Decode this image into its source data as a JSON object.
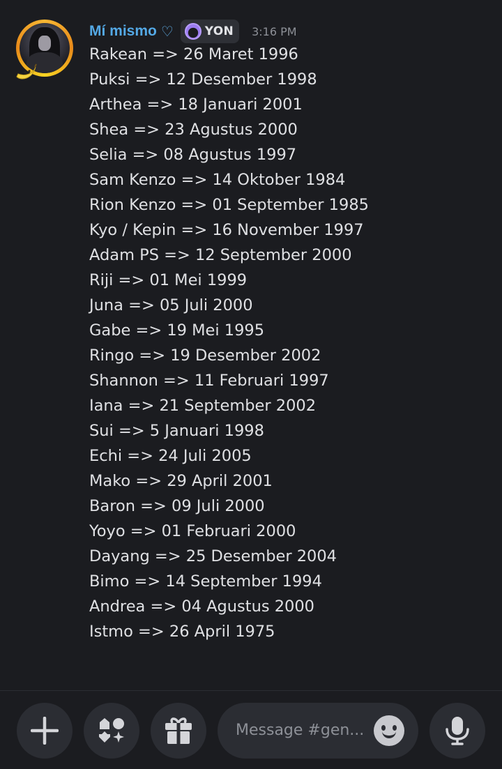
{
  "message": {
    "username": "Mí mismo",
    "heart_glyph": "♡",
    "tag": "YON",
    "timestamp": "3:16 PM",
    "lines": [
      "Rakean => 26 Maret 1996",
      "Puksi => 12 Desember 1998",
      "Arthea => 18 Januari 2001",
      "Shea => 23 Agustus 2000",
      "Selia => 08 Agustus 1997",
      "Sam Kenzo => 14 Oktober 1984",
      "Rion Kenzo => 01 September 1985",
      "Kyo / Kepin => 16 November 1997",
      "Adam PS => 12 September 2000",
      "Riji => 01 Mei 1999",
      "Juna => 05 Juli 2000",
      "Gabe => 19 Mei 1995",
      "Ringo => 19 Desember 2002",
      "Shannon => 11 Februari 1997",
      "Iana => 21 September 2002",
      "Sui => 5 Januari 1998",
      "Echi => 24 Juli 2005",
      "Mako => 29 April 2001",
      "Baron => 09 Juli 2000",
      "Yoyo => 01 Februari 2000",
      "Dayang => 25 Desember 2004",
      "Bimo => 14 September 1994",
      "Andrea => 04 Agustus 2000",
      "Istmo => 26 April 1975"
    ]
  },
  "composer": {
    "placeholder": "Message #gen...",
    "buttons": [
      "plus-icon",
      "apps-icon",
      "gift-icon",
      "emoji-icon",
      "microphone-icon"
    ]
  },
  "colors": {
    "background": "#1b1c20",
    "username": "#54a9e6",
    "text": "#dfe0e3",
    "muted": "#8d9097",
    "button_bg": "#2b2d33"
  }
}
